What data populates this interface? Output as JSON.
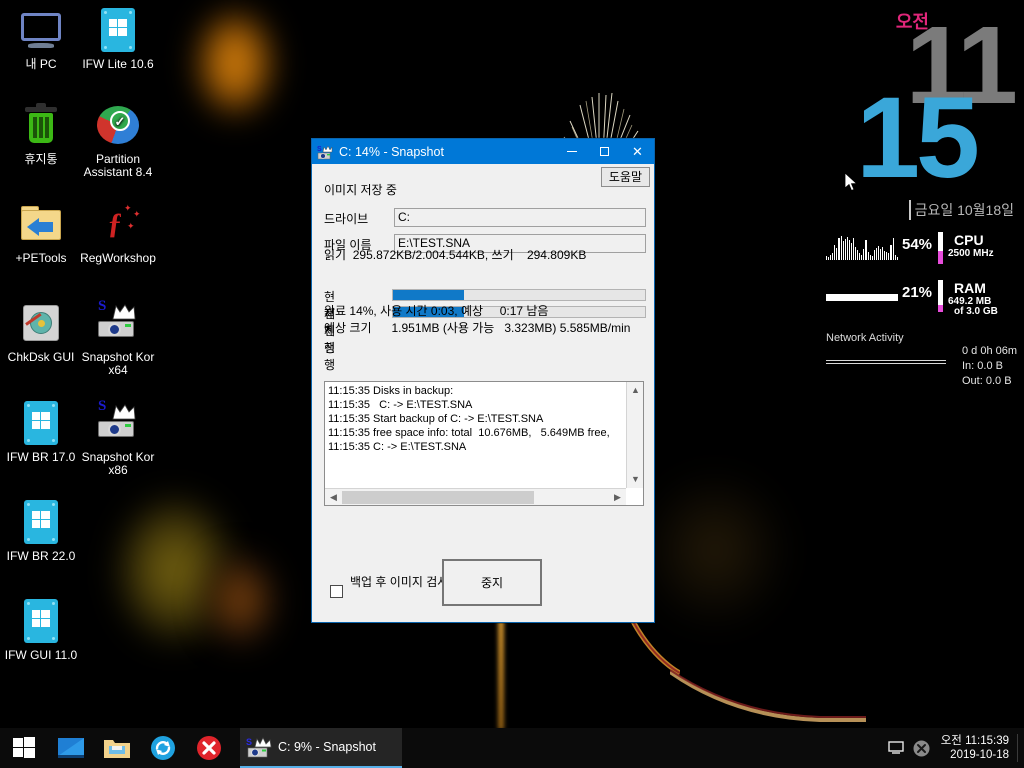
{
  "desktop": {
    "icons": [
      {
        "name": "my-pc",
        "label": "내 PC",
        "art": "pc"
      },
      {
        "name": "ifw-lite",
        "label": "IFW Lite 10.6",
        "art": "winbox"
      },
      {
        "name": "recycle-bin",
        "label": "휴지통",
        "art": "bin"
      },
      {
        "name": "partition-assistant",
        "label": "Partition\nAssistant 8.4",
        "art": "pie"
      },
      {
        "name": "petools",
        "label": "+PETools",
        "art": "folder"
      },
      {
        "name": "regworkshop",
        "label": "RegWorkshop",
        "art": "reg"
      },
      {
        "name": "chkdsk-gui",
        "label": "ChkDsk GUI",
        "art": "hdd"
      },
      {
        "name": "snapshot-kor-x64",
        "label": "Snapshot Kor\nx64",
        "art": "snap"
      },
      {
        "name": "ifw-br-17",
        "label": "IFW BR 17.0",
        "art": "winbox"
      },
      {
        "name": "snapshot-kor-x86",
        "label": "Snapshot Kor\nx86",
        "art": "snap"
      },
      {
        "name": "ifw-br-22",
        "label": "IFW BR 22.0",
        "art": "winbox"
      },
      {
        "name": "ifw-gui-11",
        "label": "IFW GUI 11.0",
        "art": "winbox"
      }
    ]
  },
  "clock_gadget": {
    "ampm": "오전",
    "hour": "11",
    "minute": "15",
    "date": "금요일 10월18일",
    "hour_color": "#7b7b7b",
    "minute_color": "#3aa7d9",
    "ampm_color": "#e0267a"
  },
  "sysmon": {
    "cpu": {
      "percent": "54%",
      "title": "CPU",
      "subtitle": "2500 MHz",
      "graph_values": [
        4,
        3,
        5,
        6,
        14,
        11,
        20,
        22,
        17,
        19,
        21,
        18,
        16,
        20,
        12,
        9,
        6,
        5,
        10,
        18,
        7,
        5,
        4,
        9,
        11,
        13,
        10,
        12,
        8,
        7,
        6,
        14,
        20,
        5,
        3
      ]
    },
    "ram": {
      "percent": "21%",
      "title": "RAM",
      "subtitle": "649.2 MB",
      "subtitle2": "of 3.0 GB"
    },
    "network": {
      "label": "Network Activity",
      "uptime": "0 d 0h 06m",
      "in": "In: 0.0 B",
      "out": "Out: 0.0 B"
    },
    "accent_color": "#e84ddb"
  },
  "window": {
    "title": "C: 14% - Snapshot",
    "icon": "snapshot-icon",
    "titlebar_color": "#0078d7",
    "buttons": {
      "minimize": "minimize-icon",
      "maximize": "maximize-icon",
      "close": "✕"
    },
    "help_button": "도움말",
    "status": "이미지 저장 중",
    "fields": [
      {
        "name": "drive",
        "label": "드라이브",
        "value": "C:"
      },
      {
        "name": "filename",
        "label": "파일 이름",
        "value": "E:\\TEST.SNA"
      }
    ],
    "read_write_line": "읽기  295.872KB/2.004.544KB, 쓰기    294.809KB",
    "progress": [
      {
        "name": "current",
        "label": "현재진행",
        "percent": 28
      },
      {
        "name": "total",
        "label": "전체진행",
        "percent": 28
      }
    ],
    "done_line": "완료 14%, 사용 시간 0:03, 예상     0:17 남음",
    "size_line": "예상 크기      1.951MB (사용 가능   3.323MB) 5.585MB/min",
    "log": "11:15:35 Disks in backup:\n11:15:35   C: -> E:\\TEST.SNA\n11:15:35 Start backup of C: -> E:\\TEST.SNA\n11:15:35 free space info: total  10.676MB,   5.649MB free,\n11:15:35 C: -> E:\\TEST.SNA",
    "checkbox": {
      "label": "백업 후 이미지 검사",
      "checked": false
    },
    "stop_button": "중지"
  },
  "taskbar": {
    "start": "start-icon",
    "quick_launch": [
      {
        "name": "desktop-show",
        "icon": "monitor-icon"
      },
      {
        "name": "file-explorer",
        "icon": "folder-icon"
      },
      {
        "name": "refresh-tool",
        "icon": "refresh-icon"
      },
      {
        "name": "close-tool",
        "icon": "close-circle-icon"
      }
    ],
    "task_item": {
      "label": "C: 9% - Snapshot",
      "icon": "snapshot-icon"
    },
    "tray_icons": [
      {
        "name": "ime-indicator",
        "glyph": "므"
      },
      {
        "name": "action-x-icon",
        "glyph": "✕"
      }
    ],
    "clock_time": "오전 11:15:39",
    "clock_date": "2019-10-18"
  }
}
